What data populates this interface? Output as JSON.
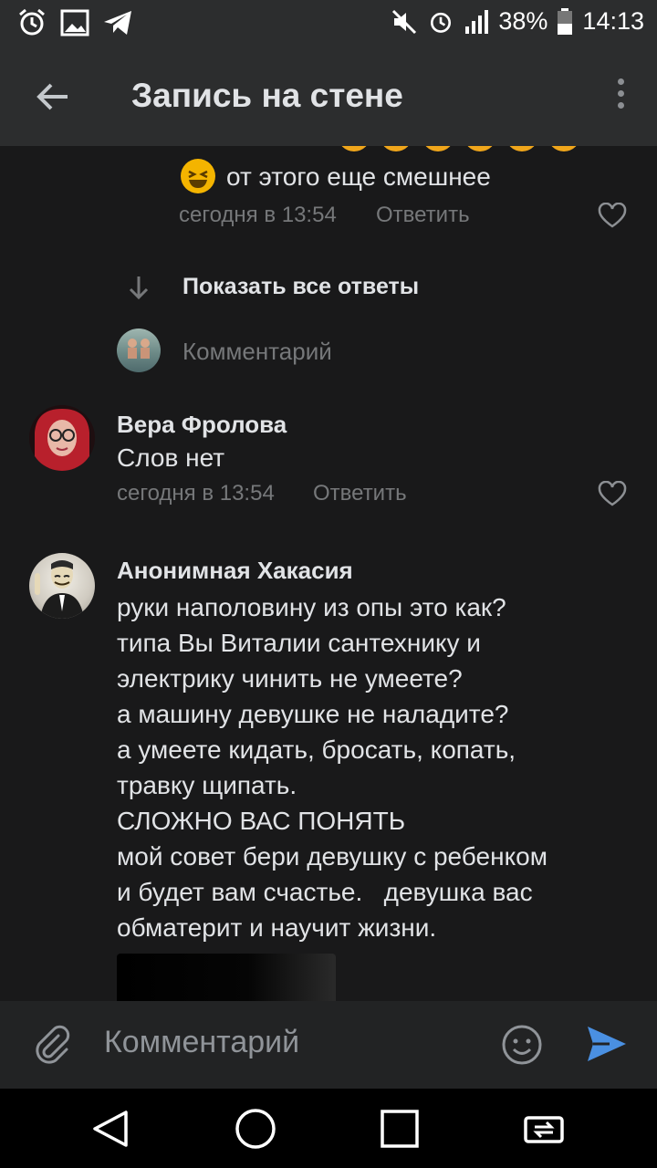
{
  "status_bar": {
    "battery": "38%",
    "time": "14:13",
    "left_icons": [
      "alarm-icon",
      "image-icon",
      "telegram-icon"
    ],
    "right_icons": [
      "mute-icon",
      "alarm-icon",
      "signal-icon",
      "battery-icon"
    ]
  },
  "header": {
    "title": "Запись на стене",
    "back_icon": "arrow-left-icon",
    "menu_icon": "more-vertical-icon"
  },
  "thread": {
    "prev_reply": {
      "text": "от этого еще смешнее",
      "time": "сегодня в 13:54",
      "reply_label": "Ответить"
    },
    "show_all": "Показать все ответы",
    "reply_placeholder": "Комментарий"
  },
  "comments": [
    {
      "author": "Вера Фролова",
      "text": "Слов нет",
      "time": "сегодня в 13:54",
      "reply_label": "Ответить"
    },
    {
      "author": "Анонимная Хакасия",
      "lines": [
        "руки наполовину из опы это как?",
        "типа Вы Виталии сантехнику и",
        "электрику чинить не умеете?",
        "а машину девушке не наладите?",
        "а умеете кидать, бросать, копать,",
        "травку щипать.",
        "СЛОЖНО ВАС ПОНЯТЬ",
        "мой совет бери девушку с ребенком",
        "и будет вам счастье.   девушка вас",
        "обматерит и научит жизни."
      ]
    }
  ],
  "composer": {
    "placeholder": "Комментарий"
  },
  "colors": {
    "background": "#19191a",
    "bar": "#2c2d2e",
    "accent": "#4a90e2",
    "secondary_text": "#76787a"
  }
}
